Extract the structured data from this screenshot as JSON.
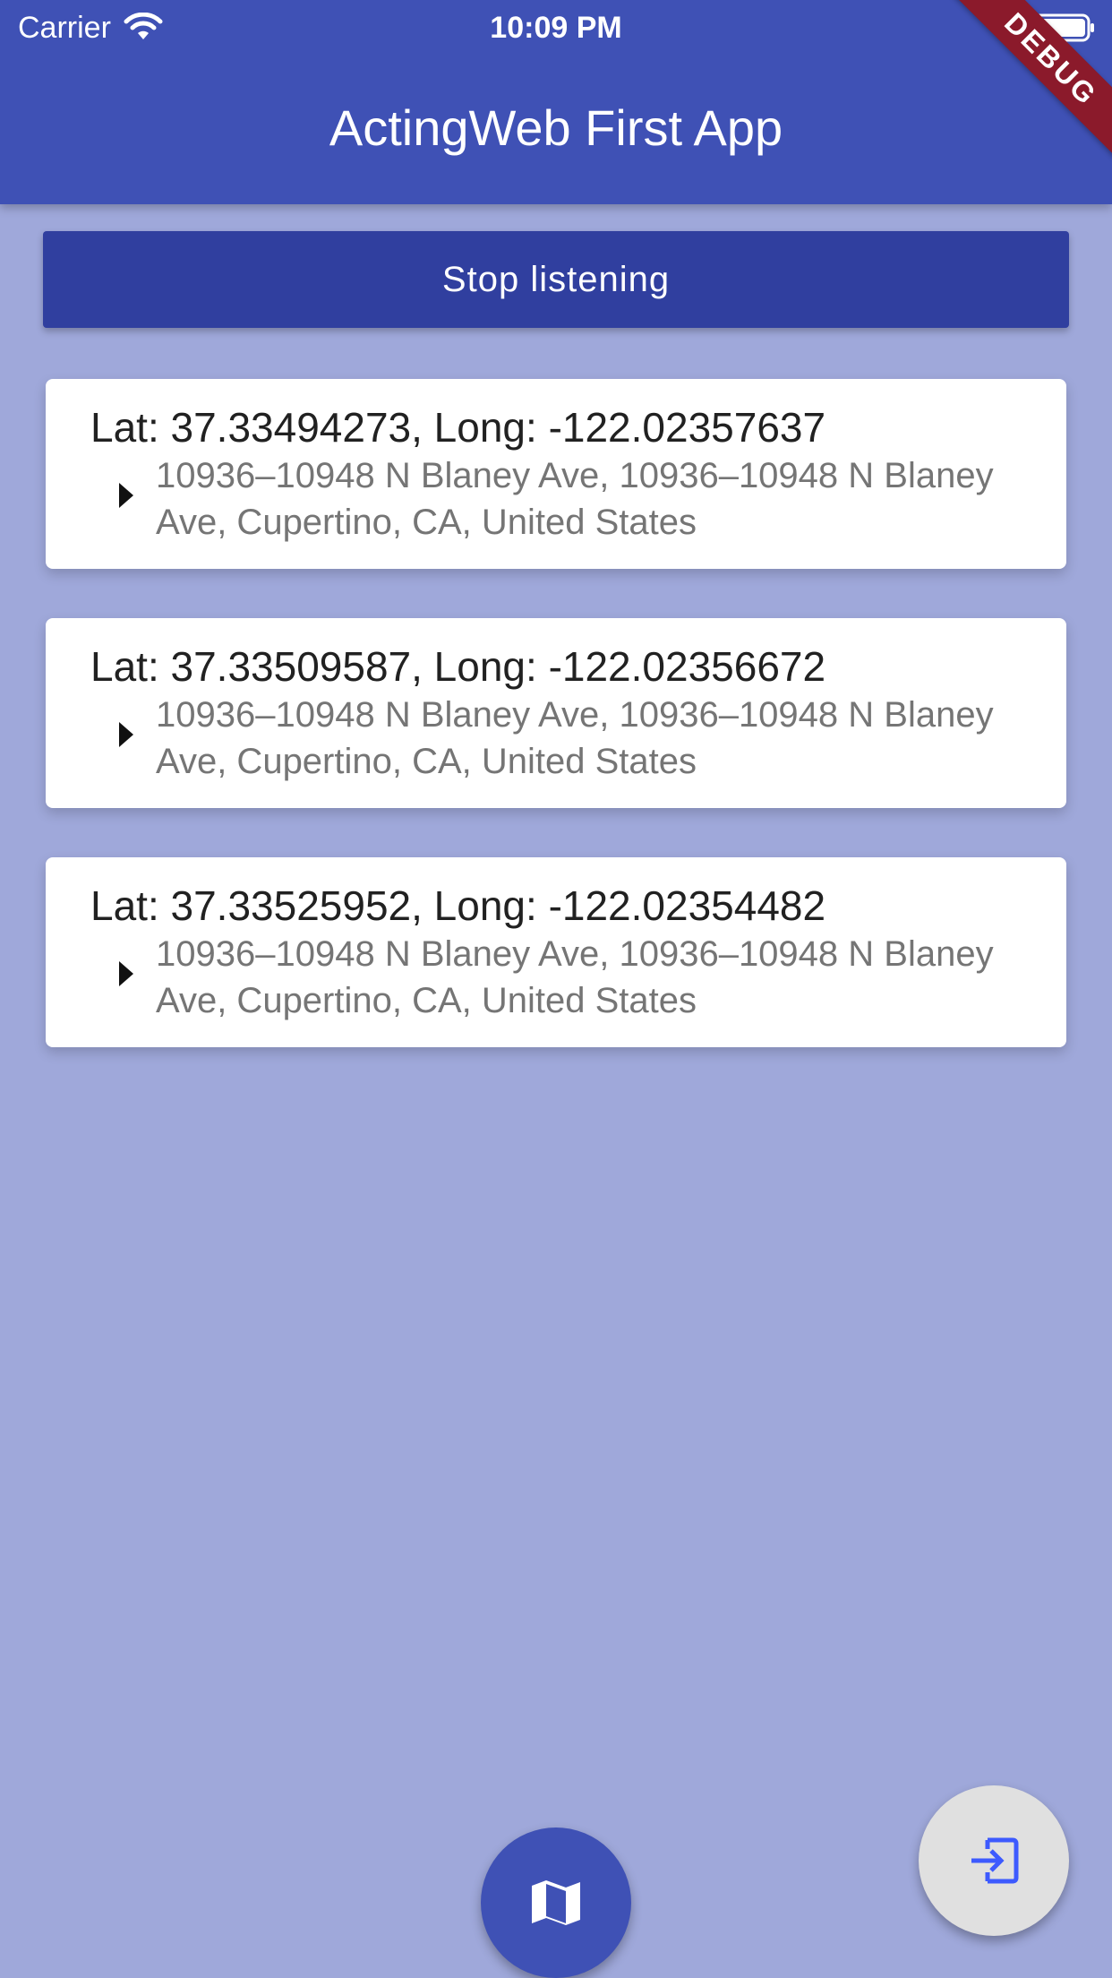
{
  "status_bar": {
    "carrier": "Carrier",
    "time": "10:09 PM",
    "wifi_icon": "wifi-icon",
    "battery_icon": "battery-icon"
  },
  "app_bar": {
    "title": "ActingWeb First App",
    "debug_banner": "DEBUG",
    "color": "#3f51b5"
  },
  "main": {
    "button_label": "Stop listening",
    "button_color": "#303f9f",
    "background": "#9fa8da",
    "locations": [
      {
        "title": "Lat: 37.33494273, Long: -122.02357637",
        "address": "10936–10948 N Blaney Ave, 10936–10948 N Blaney Ave, Cupertino, CA, United States",
        "icon": "caret-right-icon"
      },
      {
        "title": "Lat: 37.33509587, Long: -122.02356672",
        "address": "10936–10948 N Blaney Ave, 10936–10948 N Blaney Ave, Cupertino, CA, United States",
        "icon": "caret-right-icon"
      },
      {
        "title": "Lat: 37.33525952, Long: -122.02354482",
        "address": "10936–10948 N Blaney Ave, 10936–10948 N Blaney Ave, Cupertino, CA, United States",
        "icon": "caret-right-icon"
      }
    ]
  },
  "fabs": {
    "map_icon": "map-icon",
    "exit_icon": "exit-icon",
    "exit_icon_color": "#3d5afe"
  }
}
